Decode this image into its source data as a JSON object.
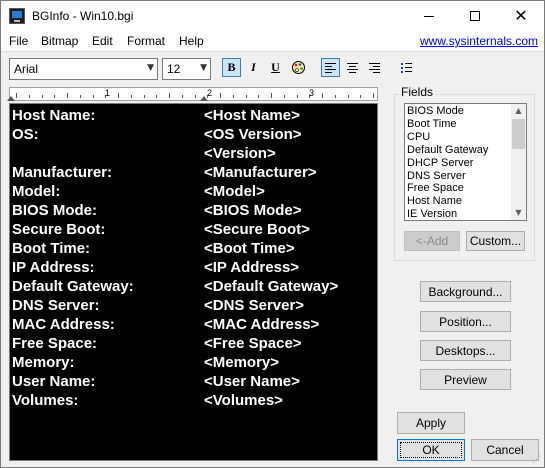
{
  "window": {
    "title": "BGInfo - Win10.bgi"
  },
  "menu": {
    "items": [
      "File",
      "Bitmap",
      "Edit",
      "Format",
      "Help"
    ],
    "link": "www.sysinternals.com"
  },
  "toolbar": {
    "font_name": "Arial",
    "font_size": "12",
    "bold": "B",
    "italic": "I",
    "underline": "U"
  },
  "ruler": {
    "numbers": [
      "1",
      "2",
      "3"
    ]
  },
  "editor": {
    "rows": [
      {
        "label": "Host Name:",
        "field": "<Host Name>"
      },
      {
        "label": "OS:",
        "field": "<OS Version>"
      },
      {
        "label": "",
        "field": "<Version>"
      },
      {
        "label": "Manufacturer:",
        "field": "<Manufacturer>"
      },
      {
        "label": "Model:",
        "field": "<Model>"
      },
      {
        "label": "BIOS Mode:",
        "field": "<BIOS Mode>"
      },
      {
        "label": "Secure Boot:",
        "field": "<Secure Boot>"
      },
      {
        "label": "Boot Time:",
        "field": "<Boot Time>"
      },
      {
        "label": "IP Address:",
        "field": "<IP Address>"
      },
      {
        "label": "Default Gateway:",
        "field": "<Default Gateway>"
      },
      {
        "label": "DNS Server:",
        "field": "<DNS Server>"
      },
      {
        "label": "MAC Address:",
        "field": "<MAC Address>"
      },
      {
        "label": "Free Space:",
        "field": "<Free Space>"
      },
      {
        "label": "Memory:",
        "field": "<Memory>"
      },
      {
        "label": "User Name:",
        "field": "<User Name>"
      },
      {
        "label": "Volumes:",
        "field": "<Volumes>"
      }
    ]
  },
  "fields": {
    "legend": "Fields",
    "items": [
      "BIOS Mode",
      "Boot Time",
      "CPU",
      "Default Gateway",
      "DHCP Server",
      "DNS Server",
      "Free Space",
      "Host Name",
      "IE Version"
    ],
    "add_label": "<-Add",
    "custom_label": "Custom..."
  },
  "side_buttons": {
    "background": "Background...",
    "position": "Position...",
    "desktops": "Desktops...",
    "preview": "Preview"
  },
  "footer": {
    "apply": "Apply",
    "ok": "OK",
    "cancel": "Cancel"
  }
}
